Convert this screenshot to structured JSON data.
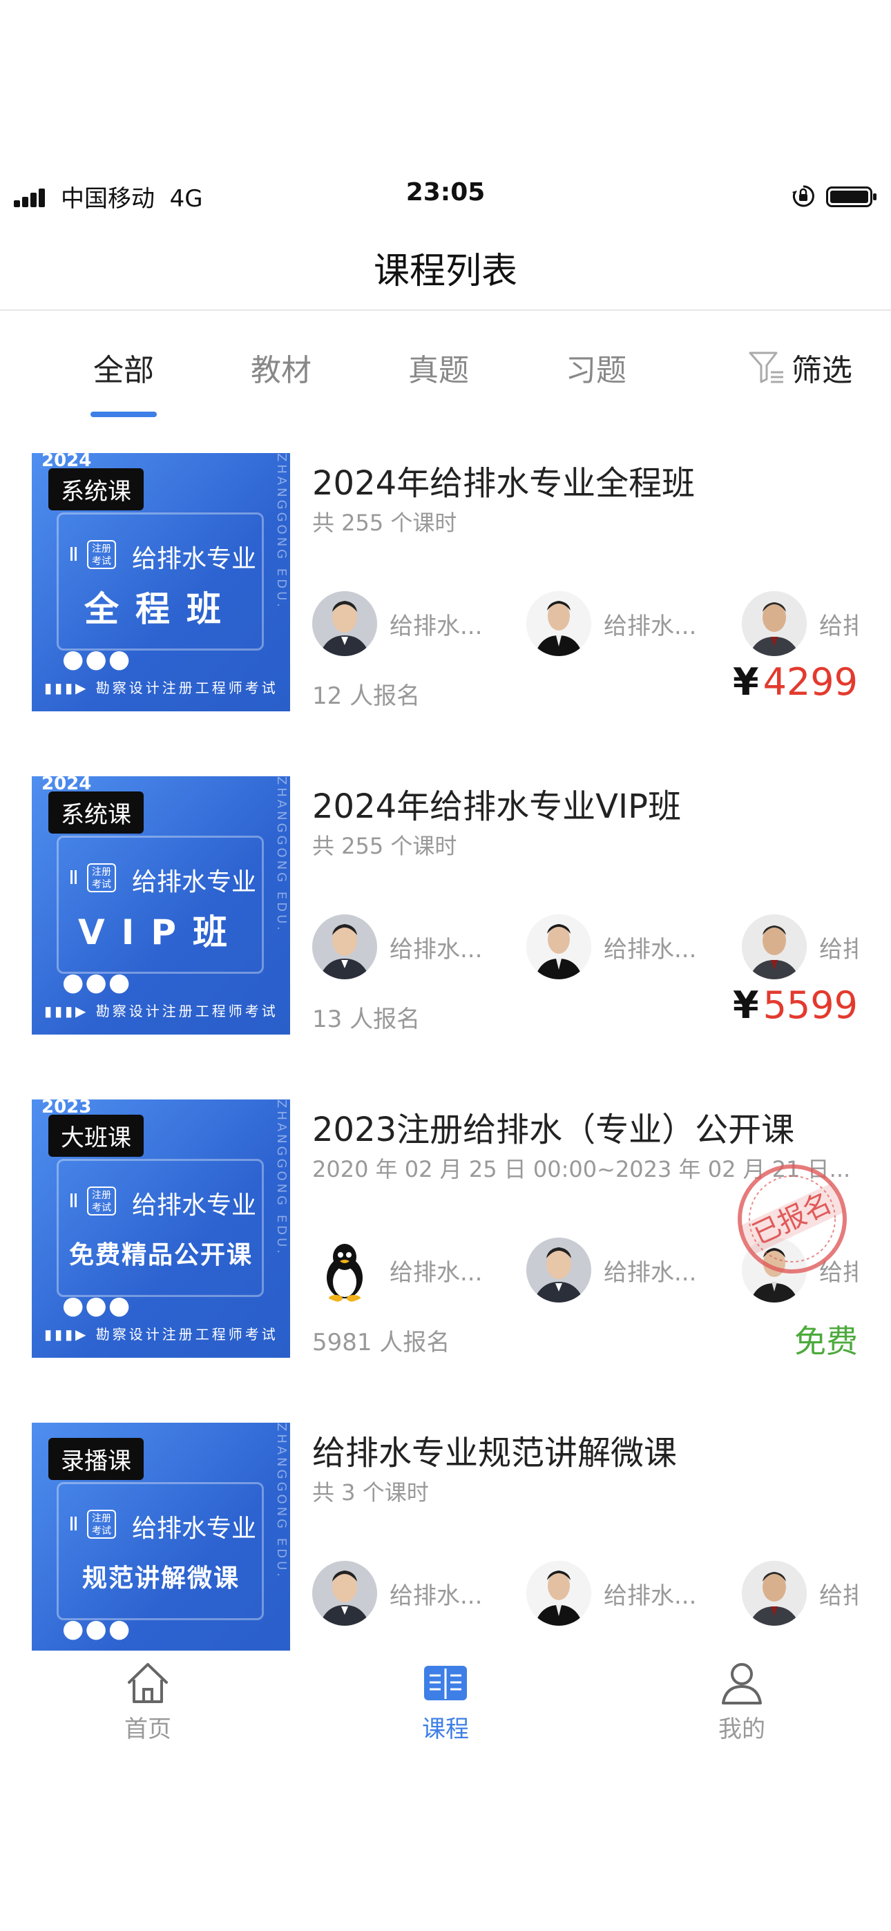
{
  "status_bar": {
    "carrier": "中国移动",
    "network": "4G",
    "time": "23:05"
  },
  "nav": {
    "title": "课程列表"
  },
  "tabs": [
    {
      "label": "全部",
      "active": true
    },
    {
      "label": "教材",
      "active": false
    },
    {
      "label": "真题",
      "active": false
    },
    {
      "label": "习题",
      "active": false
    }
  ],
  "filter": {
    "label": "筛选",
    "icon": "filter-icon"
  },
  "courses": [
    {
      "thumb": {
        "year": "2024",
        "tag": "系统课",
        "sub": "给排水专业",
        "big": "全程班",
        "badge": "注册考试",
        "footer": "勘察设计注册工程师考试",
        "vertical": "ZHANGGONG EDU."
      },
      "title": "2024年给排水专业全程班",
      "subtitle": "共 255 个课时",
      "teachers": [
        {
          "name": "给排水...",
          "avatar": "teacher-a"
        },
        {
          "name": "给排水...",
          "avatar": "teacher-b"
        },
        {
          "name": "给排",
          "avatar": "teacher-c"
        }
      ],
      "enrolled": "12 人报名",
      "price_symbol": "¥",
      "price": "4299"
    },
    {
      "thumb": {
        "year": "2024",
        "tag": "系统课",
        "sub": "给排水专业",
        "big": "VIP班",
        "badge": "注册考试",
        "footer": "勘察设计注册工程师考试",
        "vertical": "ZHANGGONG EDU."
      },
      "title": "2024年给排水专业VIP班",
      "subtitle": "共 255 个课时",
      "teachers": [
        {
          "name": "给排水...",
          "avatar": "teacher-a"
        },
        {
          "name": "给排水...",
          "avatar": "teacher-b"
        },
        {
          "name": "给排",
          "avatar": "teacher-c"
        }
      ],
      "enrolled": "13 人报名",
      "price_symbol": "¥",
      "price": "5599"
    },
    {
      "thumb": {
        "year": "2023",
        "tag": "大班课",
        "sub": "给排水专业",
        "big": "免费精品公开课",
        "badge": "注册考试",
        "footer": "勘察设计注册工程师考试",
        "vertical": "ZHANGGONG EDU."
      },
      "title": "2023注册给排水（专业）公开课",
      "subtitle": "2020 年 02 月 25 日 00:00~2023 年 02 月 21 日...",
      "teachers": [
        {
          "name": "给排水...",
          "avatar": "penguin"
        },
        {
          "name": "给排水...",
          "avatar": "teacher-a"
        },
        {
          "name": "给排",
          "avatar": "teacher-d"
        }
      ],
      "enrolled": "5981 人报名",
      "price": "免费",
      "stamp": "已报名"
    },
    {
      "thumb": {
        "year": "",
        "tag": "录播课",
        "sub": "给排水专业",
        "big": "规范讲解微课",
        "badge": "注册考试",
        "footer": "勘察设计注册工程师考试",
        "vertical": "ZHANGGONG EDU."
      },
      "title": "给排水专业规范讲解微课",
      "subtitle": "共 3 个课时",
      "teachers": [
        {
          "name": "给排水...",
          "avatar": "teacher-a"
        },
        {
          "name": "给排水...",
          "avatar": "teacher-b"
        },
        {
          "name": "给排",
          "avatar": "teacher-c"
        }
      ],
      "enrolled": "",
      "price": ""
    }
  ],
  "tabbar": [
    {
      "label": "首页",
      "icon": "home-icon",
      "active": false
    },
    {
      "label": "课程",
      "icon": "book-icon",
      "active": true
    },
    {
      "label": "我的",
      "icon": "profile-icon",
      "active": false
    }
  ],
  "colors": {
    "accent": "#3d7fe6",
    "price": "#e33a2e",
    "free": "#4caa3c"
  }
}
